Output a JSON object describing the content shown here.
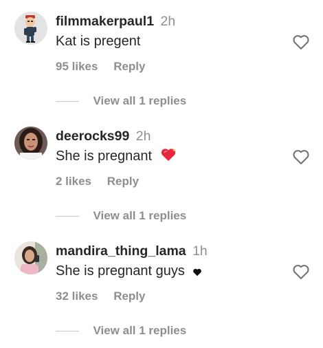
{
  "comments": [
    {
      "username": "filmmakerpaul1",
      "time": "2h",
      "text": "Kat is pregent",
      "likes": "95 likes",
      "reply_label": "Reply",
      "view_replies": "View all 1 replies"
    },
    {
      "username": "deerocks99",
      "time": "2h",
      "text": "She is pregnant",
      "emoji": "sparkling-heart-emoji",
      "likes": "2 likes",
      "reply_label": "Reply",
      "view_replies": "View all 1 replies"
    },
    {
      "username": "mandira_thing_lama",
      "time": "1h",
      "text": "She is pregnant guys",
      "emoji": "black-heart-suit",
      "likes": "32 likes",
      "reply_label": "Reply",
      "view_replies": "View all 1 replies"
    }
  ],
  "icons": {
    "like": "heart-outline-icon"
  },
  "colors": {
    "text_primary": "#262626",
    "text_secondary": "#8e8e8e",
    "divider": "#c7c7c7",
    "emoji_heart": "#e8273d"
  }
}
